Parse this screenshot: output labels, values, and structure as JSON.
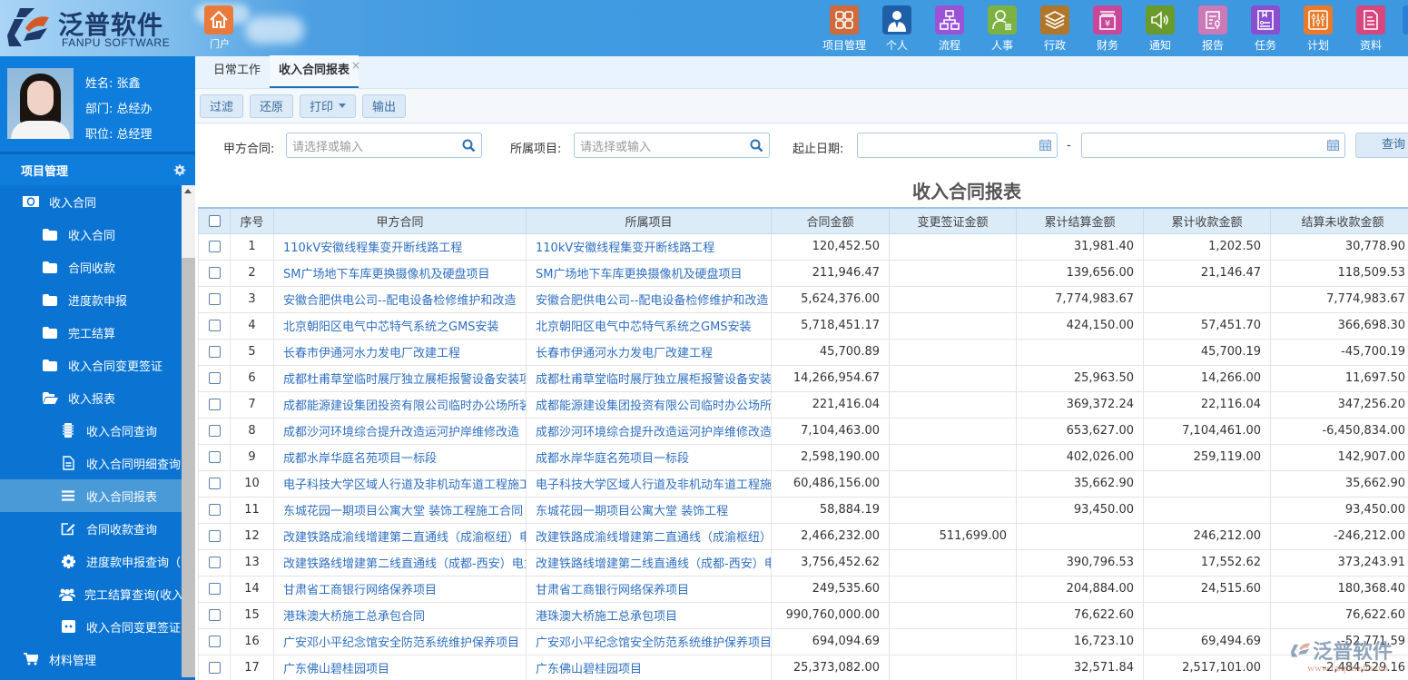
{
  "brand": {
    "title": "泛普软件",
    "subtitle": "FANPU SOFTWARE",
    "colors": {
      "navy": "#1d3a6b",
      "orange": "#d25a26"
    }
  },
  "portal": {
    "label": "门户",
    "icon": "home-icon",
    "color": "#e97a3c"
  },
  "topnav": [
    {
      "label": "项目管理",
      "icon": "grid-icon",
      "color": "#cf6a3a"
    },
    {
      "label": "个人",
      "icon": "person-icon",
      "color": "#1f5fa8"
    },
    {
      "label": "流程",
      "icon": "flowchart-icon",
      "color": "#9a52d6"
    },
    {
      "label": "人事",
      "icon": "user-list-icon",
      "color": "#7bb241"
    },
    {
      "label": "行政",
      "icon": "layers-icon",
      "color": "#b0762c"
    },
    {
      "label": "财务",
      "icon": "yuan-icon",
      "color": "#c7479a"
    },
    {
      "label": "通知",
      "icon": "speaker-icon",
      "color": "#6a9a2a"
    },
    {
      "label": "报告",
      "icon": "report-mic-icon",
      "color": "#cc79b8"
    },
    {
      "label": "任务",
      "icon": "task-icon",
      "color": "#8a4fd1"
    },
    {
      "label": "计划",
      "icon": "sliders-icon",
      "color": "#ea7a2a"
    },
    {
      "label": "资料",
      "icon": "document-icon",
      "color": "#d8467e"
    }
  ],
  "profile": {
    "name_label": "姓名: 张鑫",
    "dept_label": "部门: 总经办",
    "position_label": "职位: 总经理"
  },
  "sidebar": {
    "module_title": "项目管理",
    "items": [
      {
        "label": "收入合同",
        "icon": "money-icon",
        "level": 1
      },
      {
        "label": "收入合同",
        "icon": "folder-icon",
        "level": 2
      },
      {
        "label": "合同收款",
        "icon": "folder-icon",
        "level": 2
      },
      {
        "label": "进度款申报",
        "icon": "folder-icon",
        "level": 2
      },
      {
        "label": "完工结算",
        "icon": "folder-icon",
        "level": 2
      },
      {
        "label": "收入合同变更签证",
        "icon": "folder-icon",
        "level": 2
      },
      {
        "label": "收入报表",
        "icon": "folder-open-icon",
        "level": 2
      },
      {
        "label": "收入合同查询",
        "icon": "chip-icon",
        "level": 3
      },
      {
        "label": "收入合同明细查询",
        "icon": "file-text-icon",
        "level": 3
      },
      {
        "label": "收入合同报表",
        "icon": "list-icon",
        "level": 3,
        "active": true
      },
      {
        "label": "合同收款查询",
        "icon": "edit-icon",
        "level": 3
      },
      {
        "label": "进度款申报查询（",
        "icon": "cog-icon",
        "level": 3
      },
      {
        "label": "完工结算查询(收入",
        "icon": "users-icon",
        "level": 3
      },
      {
        "label": "收入合同变更签证",
        "icon": "robot-icon",
        "level": 3
      },
      {
        "label": "材料管理",
        "icon": "cart-icon",
        "level": 1
      }
    ]
  },
  "tabs": [
    {
      "label": "日常工作",
      "active": false
    },
    {
      "label": "收入合同报表",
      "active": true,
      "closable": true,
      "close_glyph": "×"
    }
  ],
  "toolbar": {
    "filter_label": "过滤",
    "reset_label": "还原",
    "print_label": "打印",
    "export_label": "输出"
  },
  "filters": {
    "party_a_label": "甲方合同:",
    "party_a_placeholder": "请选择或输入",
    "project_label": "所属项目:",
    "project_placeholder": "请选择或输入",
    "date_label": "起止日期:",
    "date_separator": "-",
    "start_date": "",
    "end_date": "",
    "query_label": "查询"
  },
  "report": {
    "title": "收入合同报表",
    "columns": [
      "序号",
      "甲方合同",
      "所属项目",
      "合同金额",
      "变更签证金额",
      "累计结算金额",
      "累计收款金额",
      "结算未收款金额"
    ],
    "rows": [
      {
        "no": "1",
        "contract": "110kV安徽线程集变开断线路工程",
        "project": "110kV安徽线程集变开断线路工程",
        "amount": "120,452.50",
        "change": "",
        "settled": "31,981.40",
        "received": "1,202.50",
        "unreceived": "30,778.90"
      },
      {
        "no": "2",
        "contract": "SM广场地下车库更换摄像机及硬盘项目",
        "project": "SM广场地下车库更换摄像机及硬盘项目",
        "amount": "211,946.47",
        "change": "",
        "settled": "139,656.00",
        "received": "21,146.47",
        "unreceived": "118,509.53"
      },
      {
        "no": "3",
        "contract": "安徽合肥供电公司--配电设备检修维护和改造",
        "project": "安徽合肥供电公司--配电设备检修维护和改造",
        "amount": "5,624,376.00",
        "change": "",
        "settled": "7,774,983.67",
        "received": "",
        "unreceived": "7,774,983.67"
      },
      {
        "no": "4",
        "contract": "北京朝阳区电气中芯特气系统之GMS安装",
        "project": "北京朝阳区电气中芯特气系统之GMS安装",
        "amount": "5,718,451.17",
        "change": "",
        "settled": "424,150.00",
        "received": "57,451.70",
        "unreceived": "366,698.30"
      },
      {
        "no": "5",
        "contract": "长春市伊通河水力发电厂改建工程",
        "project": "长春市伊通河水力发电厂改建工程",
        "amount": "45,700.89",
        "change": "",
        "settled": "",
        "received": "45,700.19",
        "unreceived": "-45,700.19"
      },
      {
        "no": "6",
        "contract": "成都杜甫草堂临时展厅独立展柜报警设备安装项",
        "project": "成都杜甫草堂临时展厅独立展柜报警设备安装",
        "amount": "14,266,954.67",
        "change": "",
        "settled": "25,963.50",
        "received": "14,266.00",
        "unreceived": "11,697.50"
      },
      {
        "no": "7",
        "contract": "成都能源建设集团投资有限公司临时办公场所装",
        "project": "成都能源建设集团投资有限公司临时办公场所",
        "amount": "221,416.04",
        "change": "",
        "settled": "369,372.24",
        "received": "22,116.04",
        "unreceived": "347,256.20"
      },
      {
        "no": "8",
        "contract": "成都沙河环境综合提升改造运河护岸维修改造",
        "project": "成都沙河环境综合提升改造运河护岸维修改造",
        "amount": "7,104,463.00",
        "change": "",
        "settled": "653,627.00",
        "received": "7,104,461.00",
        "unreceived": "-6,450,834.00"
      },
      {
        "no": "9",
        "contract": "成都水岸华庭名苑项目一标段",
        "project": "成都水岸华庭名苑项目一标段",
        "amount": "2,598,190.00",
        "change": "",
        "settled": "402,026.00",
        "received": "259,119.00",
        "unreceived": "142,907.00"
      },
      {
        "no": "10",
        "contract": "电子科技大学区域人行道及非机动车道工程施工",
        "project": "电子科技大学区域人行道及非机动车道工程施",
        "amount": "60,486,156.00",
        "change": "",
        "settled": "35,662.90",
        "received": "",
        "unreceived": "35,662.90"
      },
      {
        "no": "11",
        "contract": "东城花园一期项目公寓大堂 装饰工程施工合同",
        "project": "东城花园一期项目公寓大堂 装饰工程",
        "amount": "58,884.19",
        "change": "",
        "settled": "93,450.00",
        "received": "",
        "unreceived": "93,450.00"
      },
      {
        "no": "12",
        "contract": "改建铁路成渝线增建第二直通线（成渝枢纽）电",
        "project": "改建铁路成渝线增建第二直通线（成渝枢纽）",
        "amount": "2,466,232.00",
        "change": "511,699.00",
        "settled": "",
        "received": "246,212.00",
        "unreceived": "-246,212.00"
      },
      {
        "no": "13",
        "contract": "改建铁路线增建第二线直通线（成都-西安）电力",
        "project": "改建铁路线增建第二线直通线（成都-西安）电",
        "amount": "3,756,452.62",
        "change": "",
        "settled": "390,796.53",
        "received": "17,552.62",
        "unreceived": "373,243.91"
      },
      {
        "no": "14",
        "contract": "甘肃省工商银行网络保养项目",
        "project": "甘肃省工商银行网络保养项目",
        "amount": "249,535.60",
        "change": "",
        "settled": "204,884.00",
        "received": "24,515.60",
        "unreceived": "180,368.40"
      },
      {
        "no": "15",
        "contract": "港珠澳大桥施工总承包合同",
        "project": "港珠澳大桥施工总承包项目",
        "amount": "990,760,000.00",
        "change": "",
        "settled": "76,622.60",
        "received": "",
        "unreceived": "76,622.60"
      },
      {
        "no": "16",
        "contract": "广安邓小平纪念馆安全防范系统维护保养项目",
        "project": "广安邓小平纪念馆安全防范系统维护保养项目",
        "amount": "694,094.69",
        "change": "",
        "settled": "16,723.10",
        "received": "69,494.69",
        "unreceived": "-52,771.59"
      },
      {
        "no": "17",
        "contract": "广东佛山碧桂园项目",
        "project": "广东佛山碧桂园项目",
        "amount": "25,373,082.00",
        "change": "",
        "settled": "32,571.84",
        "received": "2,517,101.00",
        "unreceived": "-2,484,529.16"
      }
    ]
  },
  "watermark": {
    "text": "泛普软件",
    "url": "www.fanpusoft.com"
  }
}
